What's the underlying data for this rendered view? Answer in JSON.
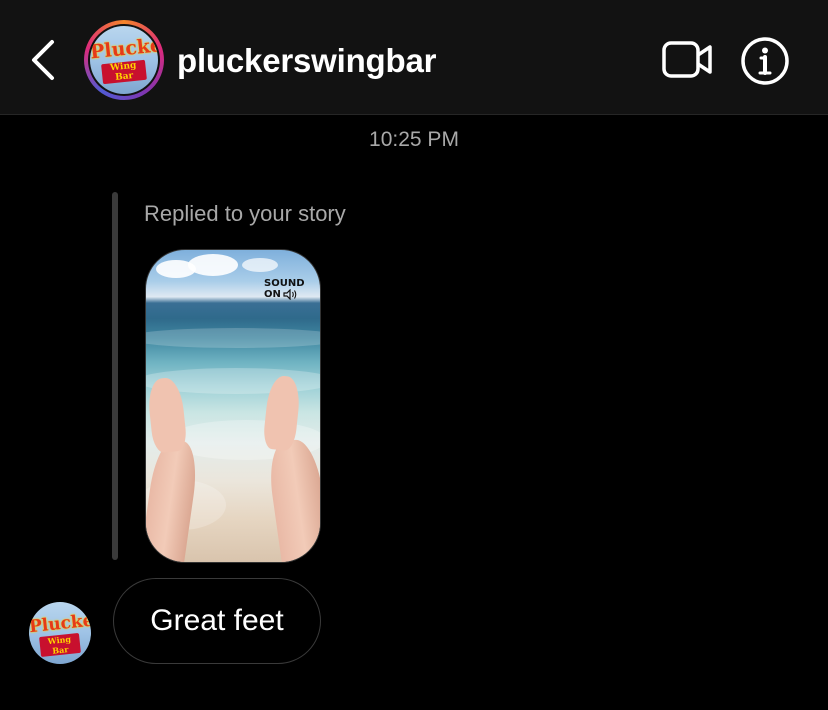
{
  "header": {
    "username": "pluckerswingbar",
    "avatar_sign_text": "Pluckers",
    "avatar_sub_text": "Wing Bar"
  },
  "thread": {
    "timestamp": "10:25 PM",
    "reply_label": "Replied to your story",
    "story_sticker_line1": "SOUND",
    "story_sticker_line2": "ON",
    "message_text": "Great feet"
  },
  "icons": {
    "back": "chevron-left-icon",
    "video": "video-camera-icon",
    "info": "info-icon",
    "speaker": "speaker-icon"
  },
  "colors": {
    "background": "#000000",
    "header_bg": "#121212",
    "secondary_text": "#a8a8a8",
    "ring_start": "#f58529",
    "ring_mid": "#dd2a7b",
    "ring_end": "#8134af"
  }
}
